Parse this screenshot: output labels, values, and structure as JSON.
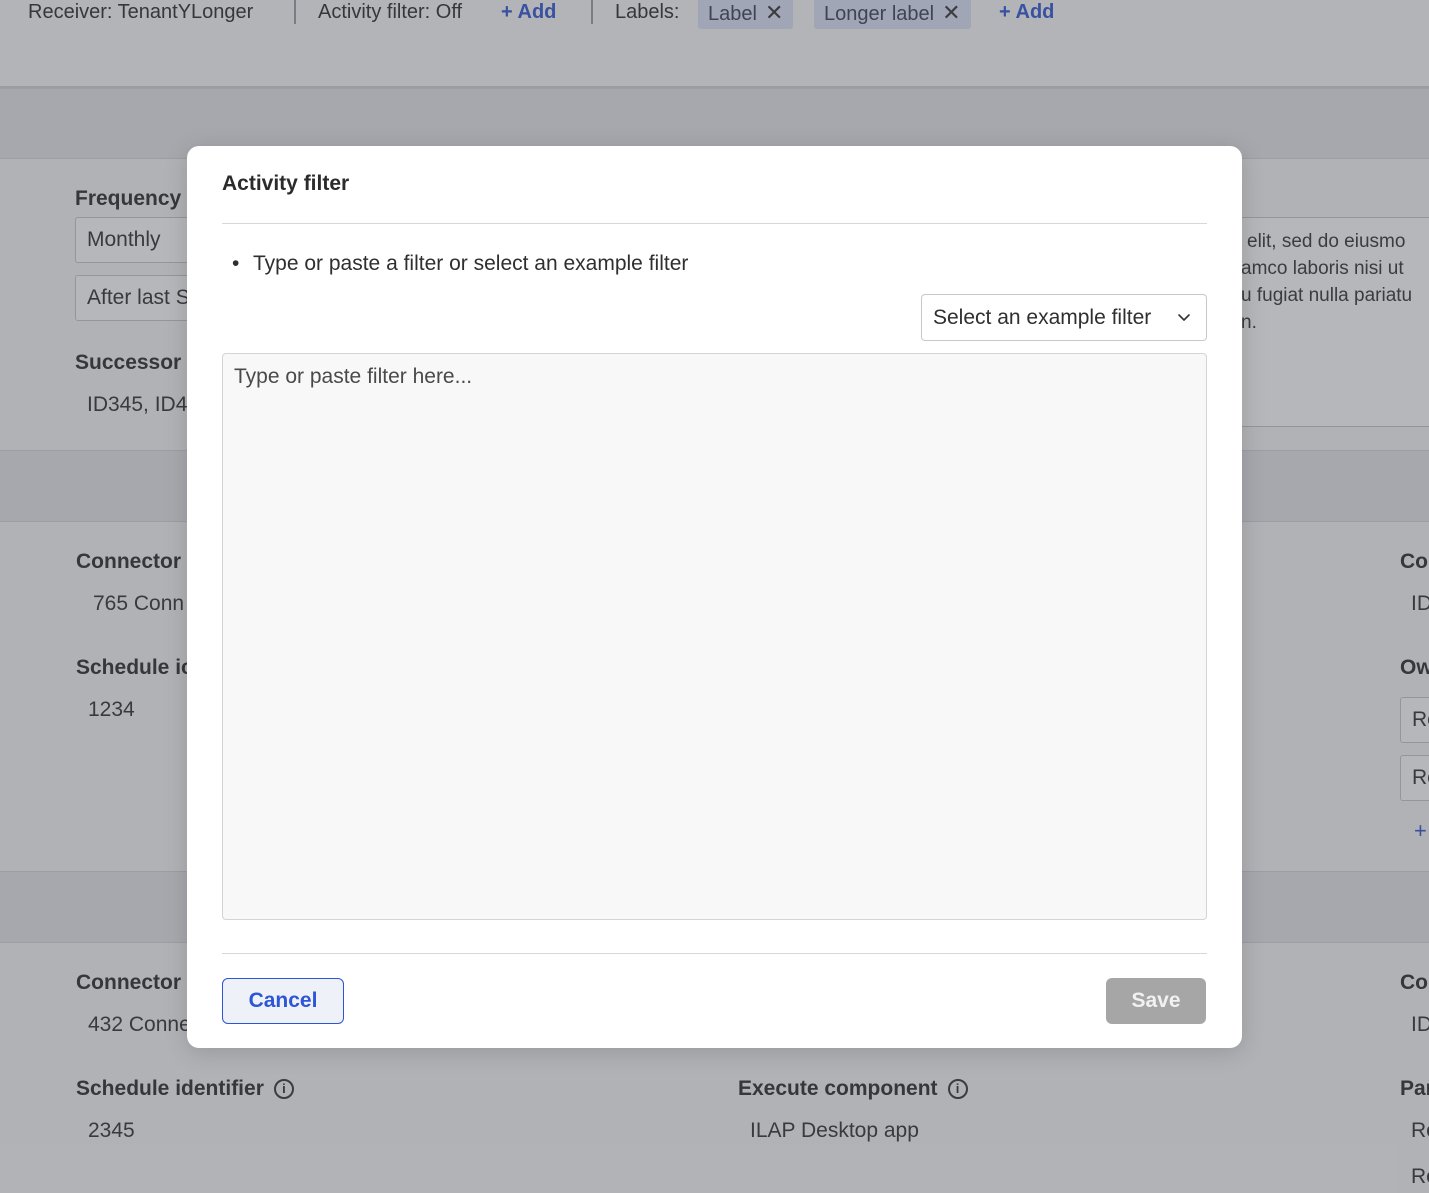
{
  "topbar": {
    "receiver": "Receiver: TenantYLonger",
    "activity_filter": "Activity filter: Off",
    "add_filter": "+ Add",
    "labels_title": "Labels:",
    "labels": [
      "Label",
      "Longer label"
    ],
    "add_label": "+ Add"
  },
  "section1": {
    "frequency_label": "Frequency",
    "frequency_value": "Monthly",
    "frequency_rule": "After last S",
    "successor_label": "Successor",
    "successor_value": "ID345, ID4",
    "description_lines": [
      "elit, sed do eiusmo",
      "amco laboris nisi ut",
      "u fugiat nulla pariatu",
      "n."
    ]
  },
  "section2": {
    "connector_label": "Connector",
    "connector_value": "765 Conn",
    "schedule_label": "Schedule ic",
    "schedule_value": "1234",
    "right_label_1": "Co",
    "right_value_1": "ID",
    "right_label_2": "Ow",
    "right_field_1": "Re",
    "right_field_2": "Re",
    "right_add": "+"
  },
  "section3": {
    "connector_label": "Connector",
    "connector_value": "432 Conne",
    "schedule_label": "Schedule identifier",
    "schedule_value": "2345",
    "execute_label": "Execute component",
    "execute_value": "ILAP Desktop app",
    "right_label_1": "Co",
    "right_value_1": "ID",
    "right_label_2": "Par",
    "right_value_2": "Re",
    "right_value_3": "Re"
  },
  "modal": {
    "title": "Activity filter",
    "instruction": "Type or paste a filter or select an example filter",
    "select_placeholder": "Select an example filter",
    "textarea_placeholder": "Type or paste filter here...",
    "cancel_label": "Cancel",
    "save_label": "Save"
  },
  "icons": {
    "info": "info-icon",
    "chevron": "chevron-down-icon",
    "close": "close-icon"
  },
  "colors": {
    "accent": "#2e55d6",
    "chip_bg": "#dbe3f7",
    "save_disabled": "#a6a6a6"
  }
}
